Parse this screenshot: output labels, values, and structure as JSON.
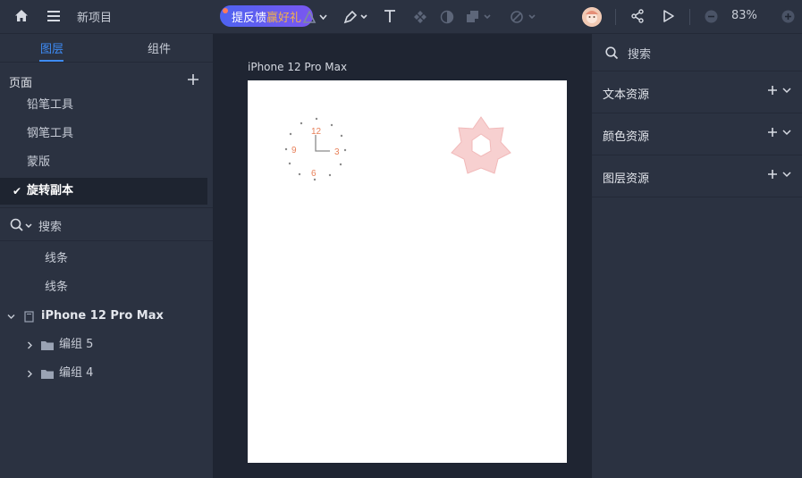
{
  "topbar": {
    "project_name": "新项目",
    "feedback_prefix": "提反馈",
    "feedback_highlight": "赢好礼",
    "zoom_level": "83%"
  },
  "left_panel": {
    "tabs": [
      {
        "label": "图层",
        "active": true
      },
      {
        "label": "组件",
        "active": false
      }
    ],
    "pages_header": "页面",
    "pages": [
      {
        "label": "铅笔工具",
        "active": false
      },
      {
        "label": "钢笔工具",
        "active": false
      },
      {
        "label": "蒙版",
        "active": false
      },
      {
        "label": "旋转副本",
        "active": true
      }
    ],
    "search_placeholder": "搜索",
    "layers": [
      {
        "label": "线条",
        "type": "line"
      },
      {
        "label": "线条",
        "type": "line"
      },
      {
        "label": "iPhone 12 Pro Max",
        "type": "artboard"
      },
      {
        "label": "编组 5",
        "type": "group"
      },
      {
        "label": "编组 4",
        "type": "group"
      }
    ]
  },
  "canvas": {
    "artboard_label": "iPhone 12 Pro Max",
    "clock_numbers": [
      "12",
      "3",
      "6",
      "9"
    ]
  },
  "right_panel": {
    "search_placeholder": "搜索",
    "sections": [
      {
        "label": "文本资源"
      },
      {
        "label": "颜色资源"
      },
      {
        "label": "图层资源"
      }
    ]
  },
  "colors": {
    "accent": "#3e8cf7",
    "panel_bg": "#2b3241",
    "canvas_bg": "#1f2532",
    "clock_number": "#e8815a",
    "star_fill": "#f7d0d0"
  }
}
